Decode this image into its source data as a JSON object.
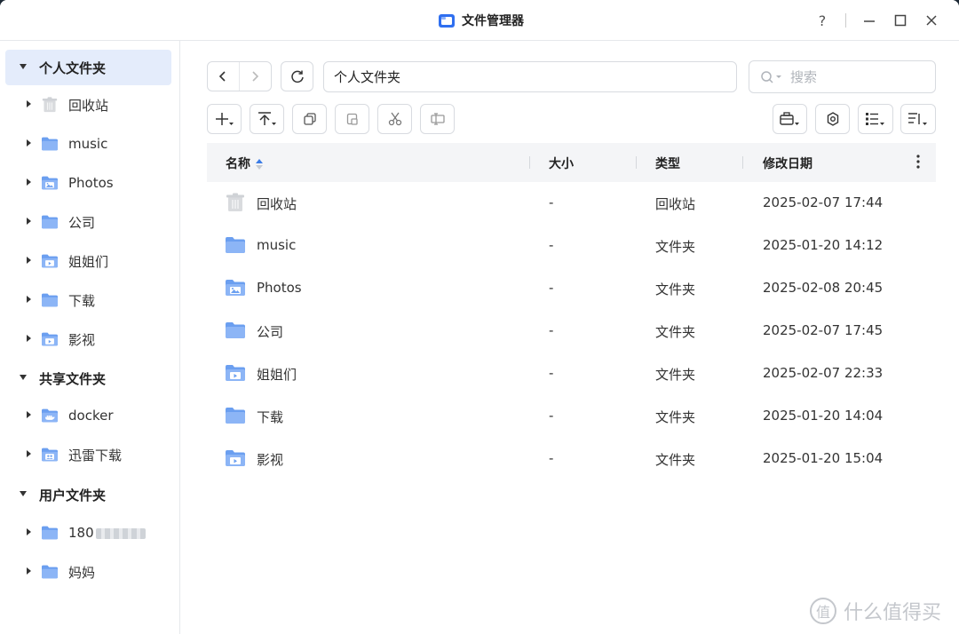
{
  "window": {
    "title": "文件管理器"
  },
  "colors": {
    "accent": "#4a8af4",
    "folder": "#6b9ff0",
    "selected": "#e4ecfb"
  },
  "sidebar": {
    "sections": [
      {
        "label": "个人文件夹",
        "items": [
          {
            "label": "回收站",
            "icon": "trash-icon"
          },
          {
            "label": "music",
            "icon": "folder-icon"
          },
          {
            "label": "Photos",
            "icon": "photos-folder-icon"
          },
          {
            "label": "公司",
            "icon": "folder-icon"
          },
          {
            "label": "姐姐们",
            "icon": "video-folder-icon"
          },
          {
            "label": "下载",
            "icon": "folder-icon"
          },
          {
            "label": "影视",
            "icon": "video-folder-icon"
          }
        ]
      },
      {
        "label": "共享文件夹",
        "items": [
          {
            "label": "docker",
            "icon": "docker-folder-icon"
          },
          {
            "label": "迅雷下载",
            "icon": "shared-folder-icon"
          }
        ]
      },
      {
        "label": "用户文件夹",
        "items": [
          {
            "label": "180",
            "icon": "folder-icon"
          },
          {
            "label": "妈妈",
            "icon": "folder-icon"
          }
        ]
      }
    ]
  },
  "path": {
    "value": "个人文件夹"
  },
  "search": {
    "placeholder": "搜索"
  },
  "table": {
    "columns": [
      "名称",
      "大小",
      "类型",
      "修改日期"
    ],
    "rows": [
      {
        "name": "回收站",
        "size": "-",
        "type": "回收站",
        "modified": "2025-02-07 17:44",
        "icon": "trash-icon"
      },
      {
        "name": "music",
        "size": "-",
        "type": "文件夹",
        "modified": "2025-01-20 14:12",
        "icon": "folder-icon"
      },
      {
        "name": "Photos",
        "size": "-",
        "type": "文件夹",
        "modified": "2025-02-08 20:45",
        "icon": "photos-folder-icon"
      },
      {
        "name": "公司",
        "size": "-",
        "type": "文件夹",
        "modified": "2025-02-07 17:45",
        "icon": "folder-icon"
      },
      {
        "name": "姐姐们",
        "size": "-",
        "type": "文件夹",
        "modified": "2025-02-07 22:33",
        "icon": "video-folder-icon"
      },
      {
        "name": "下载",
        "size": "-",
        "type": "文件夹",
        "modified": "2025-01-20 14:04",
        "icon": "folder-icon"
      },
      {
        "name": "影视",
        "size": "-",
        "type": "文件夹",
        "modified": "2025-01-20 15:04",
        "icon": "video-folder-icon"
      }
    ]
  },
  "watermark": {
    "mark": "值",
    "text": "什么值得买"
  }
}
